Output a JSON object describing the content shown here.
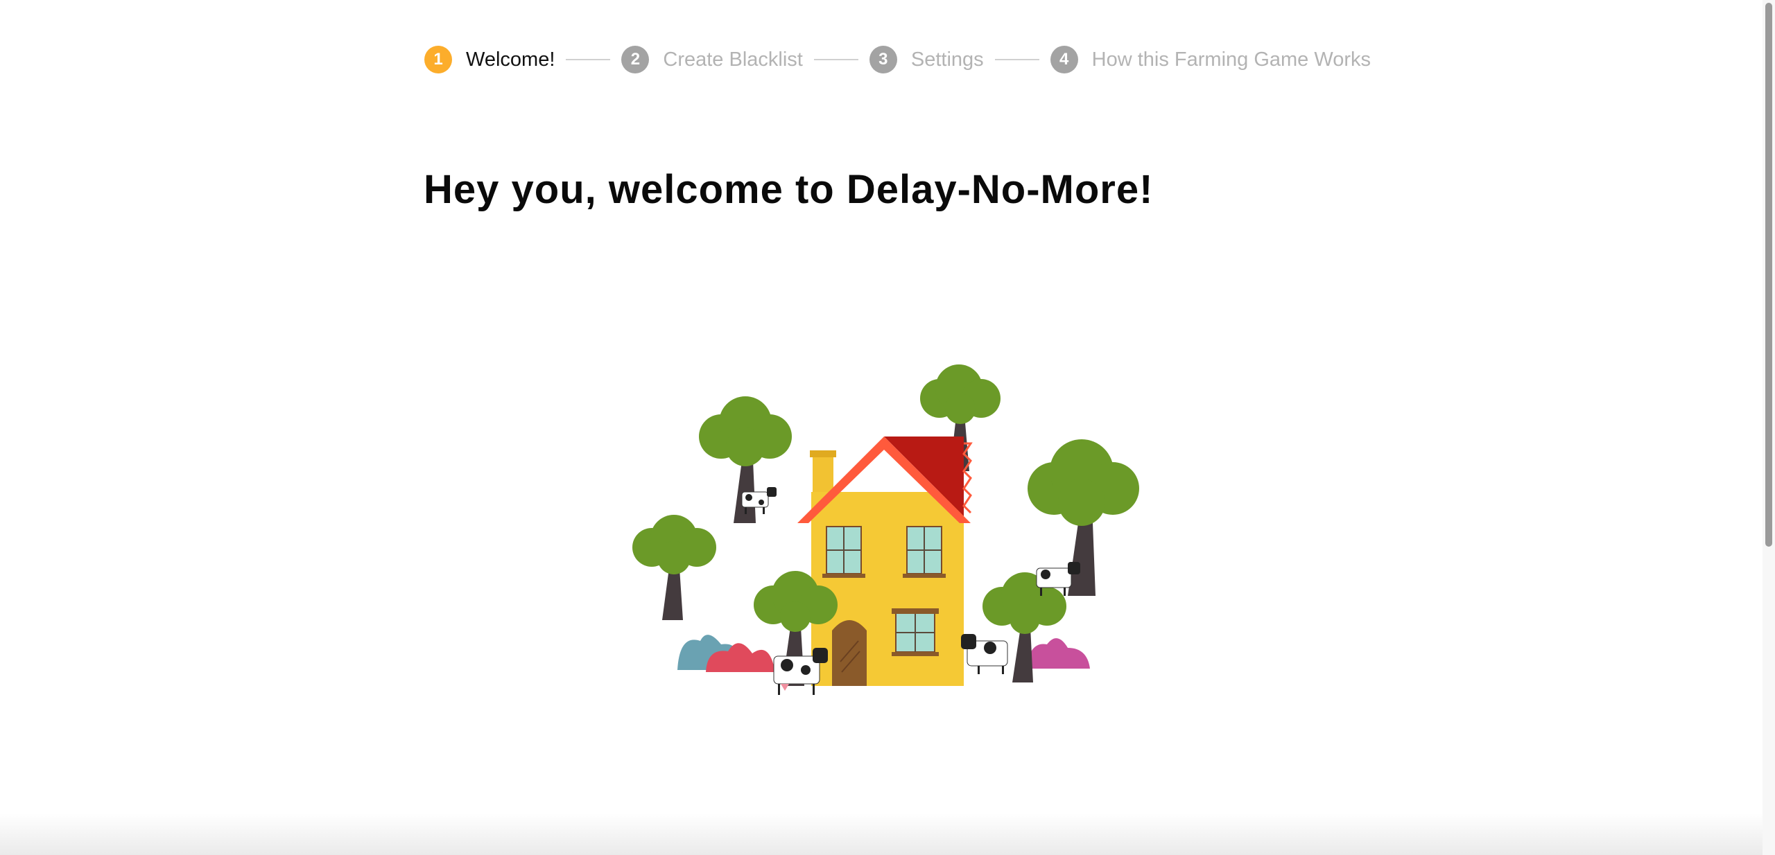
{
  "stepper": {
    "steps": [
      {
        "number": "1",
        "label": "Welcome!",
        "state": "active"
      },
      {
        "number": "2",
        "label": "Create Blacklist",
        "state": "inactive"
      },
      {
        "number": "3",
        "label": "Settings",
        "state": "inactive"
      },
      {
        "number": "4",
        "label": "How this Farming Game Works",
        "state": "inactive"
      }
    ]
  },
  "main": {
    "heading": "Hey you, welcome to Delay-No-More!"
  },
  "illustration": {
    "icon": "farmhouse-illustration"
  },
  "colors": {
    "accent": "#fcad2b",
    "inactive_step": "#a3a3a3",
    "inactive_label": "#b3b3b3",
    "house_wall": "#f5c935",
    "roof": "#ff5a3c",
    "roof_dark": "#b81a14",
    "tree_foliage": "#6b9a28",
    "tree_trunk": "#443b3e"
  }
}
